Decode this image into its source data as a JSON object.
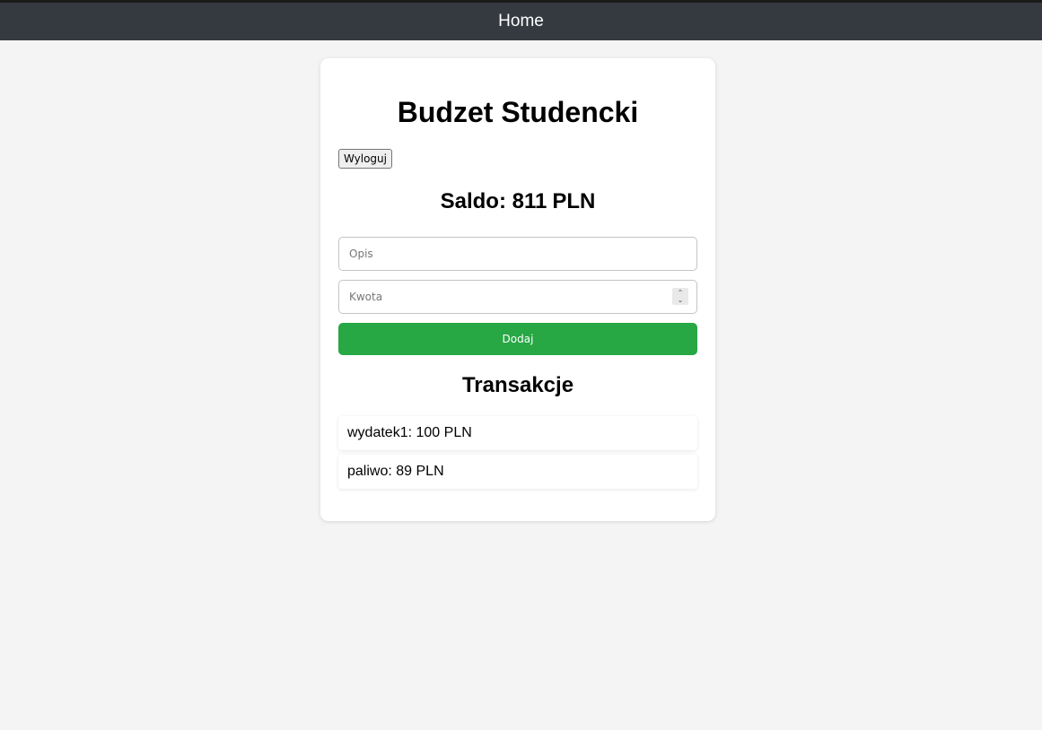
{
  "navbar": {
    "title": "Home"
  },
  "card": {
    "title": "Budzet Studencki",
    "logout_label": "Wyloguj",
    "balance": {
      "label": "Saldo:",
      "value": "811",
      "currency": "PLN"
    },
    "form": {
      "description_placeholder": "Opis",
      "description_value": "",
      "amount_placeholder": "Kwota",
      "amount_value": "",
      "add_label": "Dodaj"
    },
    "transactions": {
      "title": "Transakcje",
      "items": [
        {
          "description": "wydatek1",
          "amount": "100",
          "currency": "PLN"
        },
        {
          "description": "paliwo",
          "amount": "89",
          "currency": "PLN"
        }
      ]
    }
  },
  "colors": {
    "navbar_bg": "#343a40",
    "page_bg": "#f4f4f4",
    "add_button": "#28a745"
  },
  "icons": {
    "amount_spinner": "number-spinner-icon"
  }
}
